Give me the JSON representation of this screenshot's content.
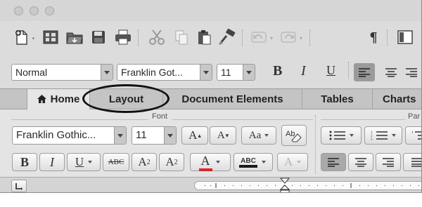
{
  "titlebar": {
    "buttons": [
      "close",
      "minimize",
      "zoom"
    ]
  },
  "toolbar": {
    "icons": [
      "new-document-icon",
      "templates-icon",
      "open-icon",
      "save-icon",
      "print-icon",
      "cut-icon",
      "copy-icon",
      "paste-icon",
      "format-painter-icon",
      "undo-icon",
      "redo-icon",
      "pilcrow-icon",
      "sidebar-icon"
    ],
    "pilcrow": "¶"
  },
  "format_bar": {
    "style_value": "Normal",
    "font_value": "Franklin Got...",
    "size_value": "11",
    "bold": "B",
    "italic": "I",
    "underline": "U"
  },
  "ribbon_tabs": [
    {
      "label": "Home",
      "active": true
    },
    {
      "label": "Layout",
      "active": false
    },
    {
      "label": "Document Elements",
      "active": false
    },
    {
      "label": "Tables",
      "active": false
    },
    {
      "label": "Charts",
      "active": false
    }
  ],
  "font_group": {
    "label": "Font",
    "font_value": "Franklin Gothic...",
    "size_value": "11",
    "grow": "A",
    "shrink": "A",
    "change_case": "Aa",
    "bold": "B",
    "italic": "I",
    "underline": "U",
    "strikethrough": "ABC",
    "superscript": "A",
    "subscript": "A",
    "font_color": "A",
    "highlight": "ABC",
    "text_effects": "A"
  },
  "paragraph_group": {
    "label": "Par"
  },
  "colors": {
    "font_color_bar": "#d8262b",
    "highlight_bar": "#1a1a1a",
    "annotation": "#111111"
  }
}
